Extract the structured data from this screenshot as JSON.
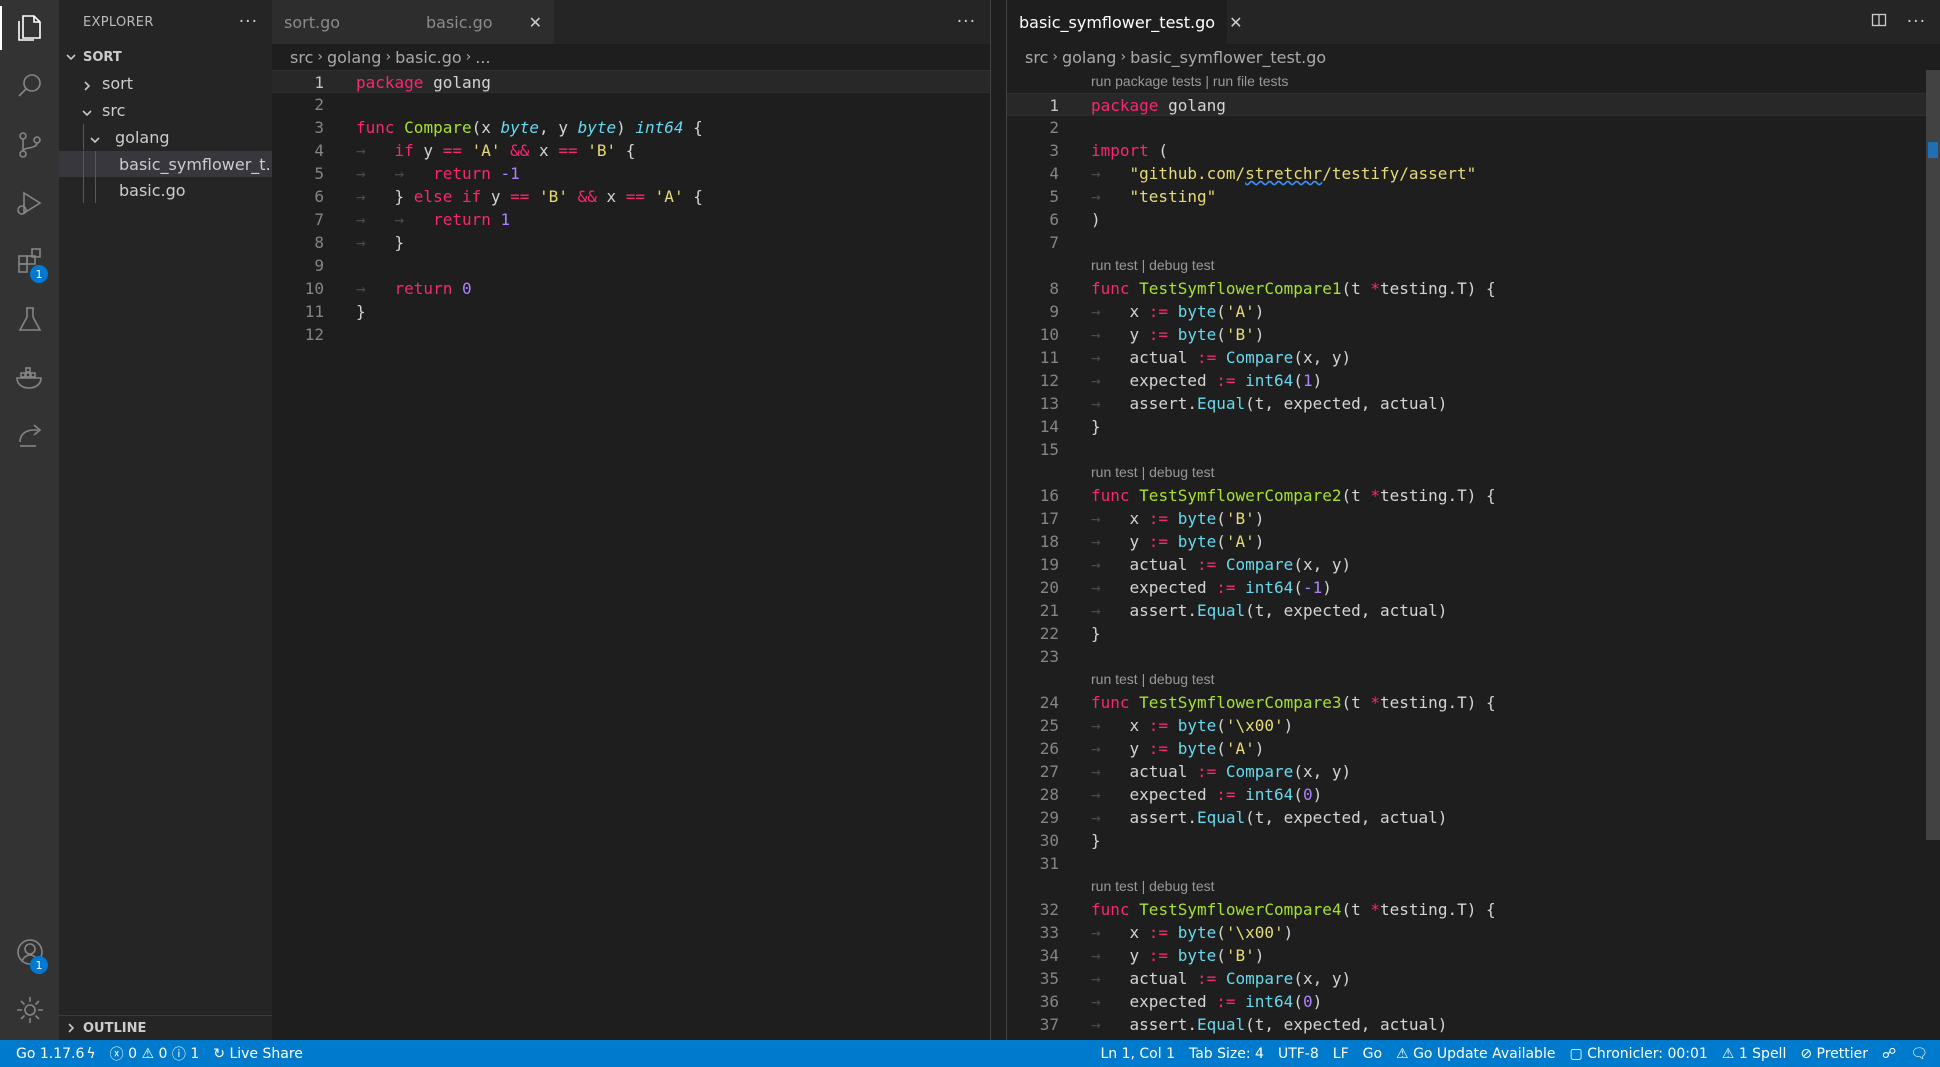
{
  "explorer": {
    "title": "EXPLORER",
    "section": "SORT",
    "outline": "OUTLINE",
    "tree": [
      {
        "label": "sort",
        "type": "folder-collapsed"
      },
      {
        "label": "src",
        "type": "folder-open"
      },
      {
        "label": "golang",
        "type": "folder-open"
      },
      {
        "label": "basic_symflower_t...",
        "type": "file"
      },
      {
        "label": "basic.go",
        "type": "file"
      }
    ]
  },
  "activity": {
    "extensions_badge": "1",
    "accounts_badge": "1"
  },
  "left_editor": {
    "tabs": [
      {
        "label": "sort.go"
      },
      {
        "label": "basic.go"
      }
    ],
    "close_glyph": "✕",
    "breadcrumb": [
      "src",
      "golang",
      "basic.go",
      "..."
    ],
    "line_numbers": [
      "1",
      "2",
      "3",
      "4",
      "5",
      "6",
      "7",
      "8",
      "9",
      "10",
      "11",
      "12"
    ]
  },
  "right_editor": {
    "tab": "basic_symflower_test.go",
    "close_glyph": "✕",
    "breadcrumb": [
      "src",
      "golang",
      "basic_symflower_test.go"
    ],
    "codelens_top": "run package tests | run file tests",
    "codelens": [
      "run test | debug test",
      "run test | debug test",
      "run test | debug test",
      "run test | debug test"
    ],
    "line_numbers": [
      "1",
      "2",
      "3",
      "4",
      "5",
      "6",
      "7",
      "8",
      "9",
      "10",
      "11",
      "12",
      "13",
      "14",
      "15",
      "16",
      "17",
      "18",
      "19",
      "20",
      "21",
      "22",
      "23",
      "24",
      "25",
      "26",
      "27",
      "28",
      "29",
      "30",
      "31",
      "32",
      "33",
      "34",
      "35",
      "36",
      "37"
    ]
  },
  "status": {
    "go_version": "Go 1.17.6",
    "errors": "0",
    "warnings": "0",
    "info": "1",
    "live_share": "Live Share",
    "position": "Ln 1, Col 1",
    "tab_size": "Tab Size: 4",
    "encoding": "UTF-8",
    "eol": "LF",
    "language": "Go",
    "go_update": "Go Update Available",
    "chronicler": "Chronicler: 00:01",
    "spell": "1 Spell",
    "prettier": "Prettier"
  }
}
